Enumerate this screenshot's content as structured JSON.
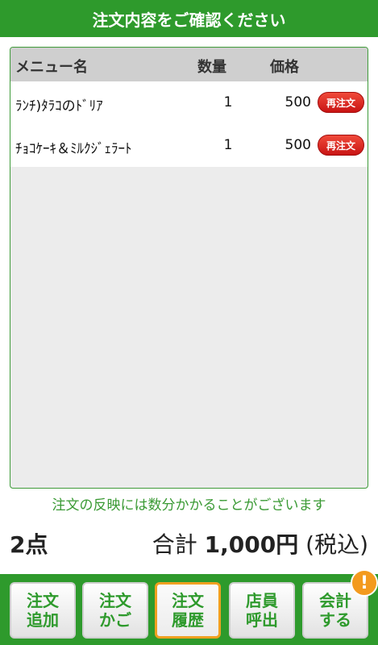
{
  "header": {
    "title": "注文内容をご確認ください"
  },
  "table": {
    "columns": {
      "name": "メニュー名",
      "qty": "数量",
      "price": "価格"
    },
    "rows": [
      {
        "name": "ﾗﾝﾁ)ﾀﾗｺのﾄﾞﾘｱ",
        "qty": "1",
        "price": "500",
        "action": "再注文"
      },
      {
        "name": "ﾁｮｺｹｰｷ＆ﾐﾙｸｼﾞｪﾗｰﾄ",
        "qty": "1",
        "price": "500",
        "action": "再注文"
      }
    ]
  },
  "notice": "注文の反映には数分かかることがございます",
  "summary": {
    "count": "2点",
    "total_label": "合計",
    "total_amount": "1,000円",
    "tax_note": "(税込)"
  },
  "footer": {
    "buttons": [
      {
        "line1": "注文",
        "line2": "追加"
      },
      {
        "line1": "注文",
        "line2": "かご"
      },
      {
        "line1": "注文",
        "line2": "履歴"
      },
      {
        "line1": "店員",
        "line2": "呼出"
      },
      {
        "line1": "会計",
        "line2": "する"
      }
    ],
    "badge": "!"
  },
  "colors": {
    "brand": "#2e9a2c",
    "reorder": "#d91f1a",
    "active_border": "#f0a020",
    "badge": "#f39a1e"
  }
}
